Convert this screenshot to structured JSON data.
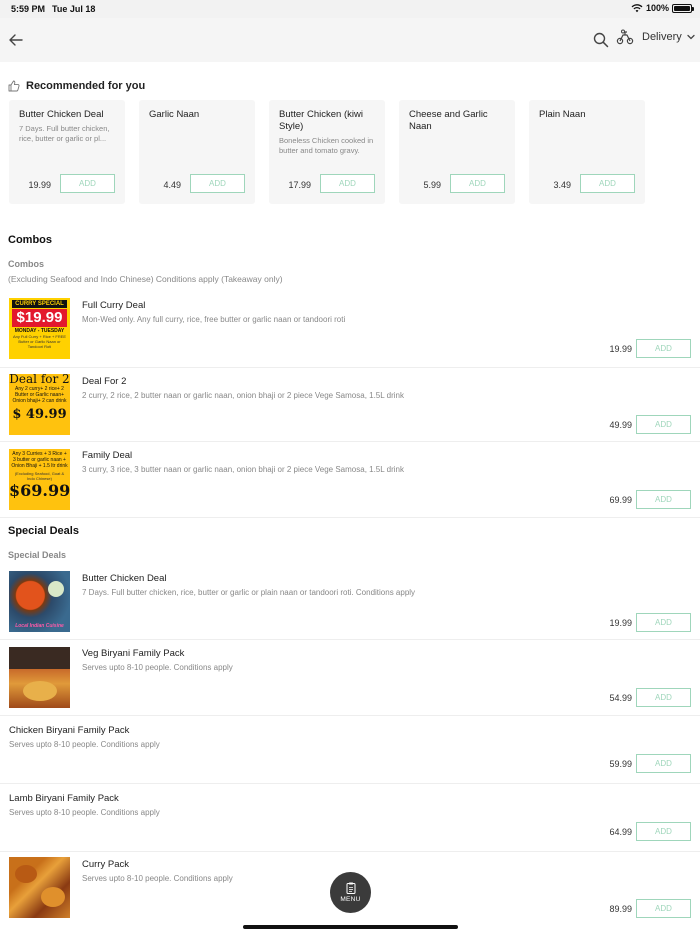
{
  "status": {
    "time": "5:59 PM",
    "date": "Tue Jul 18",
    "battery": "100%"
  },
  "topbar": {
    "back_icon": "arrow-left-icon",
    "search_icon": "search-icon",
    "delivery_label": "Delivery"
  },
  "recommended": {
    "title": "Recommended for you",
    "add_label": "ADD",
    "items": [
      {
        "name": "Butter Chicken Deal",
        "desc": "7 Days. Full butter chicken, rice, butter or garlic or pl...",
        "price": "19.99"
      },
      {
        "name": "Garlic Naan",
        "desc": "",
        "price": "4.49"
      },
      {
        "name": "Butter Chicken (kiwi Style)",
        "desc": "Boneless Chicken cooked in butter and tomato gravy.",
        "price": "17.99"
      },
      {
        "name": "Cheese and Garlic Naan",
        "desc": "",
        "price": "5.99"
      },
      {
        "name": "Plain Naan",
        "desc": "",
        "price": "3.49"
      }
    ]
  },
  "combos": {
    "title": "Combos",
    "subtitle": "Combos",
    "note": "(Excluding Seafood and Indo Chinese) Conditions apply (Takeaway only)",
    "items": [
      {
        "name": "Full Curry Deal",
        "desc": "Mon-Wed only. Any full curry, rice, free butter or garlic naan or tandoori roti",
        "price": "19.99",
        "thumb": {
          "headline": "CURRY SPECIAL",
          "price": "$19.99",
          "days": "MONDAY - TUESDAY",
          "line": "Any Full Curry + Rice + FREE Butter or Garlic Naan or Tandoori Roti"
        }
      },
      {
        "name": "Deal For 2",
        "desc": "2 curry, 2 rice, 2 butter naan or garlic naan, onion bhaji or 2 piece Vege Samosa, 1.5L drink",
        "price": "49.99",
        "thumb": {
          "headline": "Deal for 2",
          "line": "Any 2 curry+ 2 rice+ 2 Butter or Garlic naan+ Onion bhaji+ 2 can drink",
          "price": "$ 49.99"
        }
      },
      {
        "name": "Family Deal",
        "desc": "3 curry, 3 rice, 3 butter naan or garlic naan, onion bhaji or 2 piece Vege Samosa, 1.5L drink",
        "price": "69.99",
        "thumb": {
          "line": "Any 3 Curries + 3 Rice + 3 butter or garlic naan + Onion Bhaji + 1.5 ltr drink",
          "sub": "(Excluding Seafood, Goat & Indo Chinese)",
          "price": "$69.99"
        }
      }
    ]
  },
  "special": {
    "title": "Special Deals",
    "subtitle": "Special Deals",
    "items": [
      {
        "name": "Butter Chicken Deal",
        "desc": "7 Days. Full butter chicken, rice, butter or garlic or plain naan or tandoori roti. Conditions apply",
        "price": "19.99",
        "thumb_text": "Local Indian Cuisine"
      },
      {
        "name": "Veg Biryani Family Pack",
        "desc": "Serves upto 8-10 people. Conditions apply",
        "price": "54.99"
      },
      {
        "name": "Chicken Biryani Family Pack",
        "desc": "Serves upto 8-10 people. Conditions apply",
        "price": "59.99"
      },
      {
        "name": "Lamb Biryani Family Pack",
        "desc": "Serves upto 8-10 people. Conditions apply",
        "price": "64.99"
      },
      {
        "name": "Curry Pack",
        "desc": "Serves upto 8-10 people. Conditions apply",
        "price": "89.99"
      }
    ]
  },
  "add_label": "ADD",
  "menu_button": {
    "label": "MENU",
    "icon": "clipboard-icon"
  }
}
